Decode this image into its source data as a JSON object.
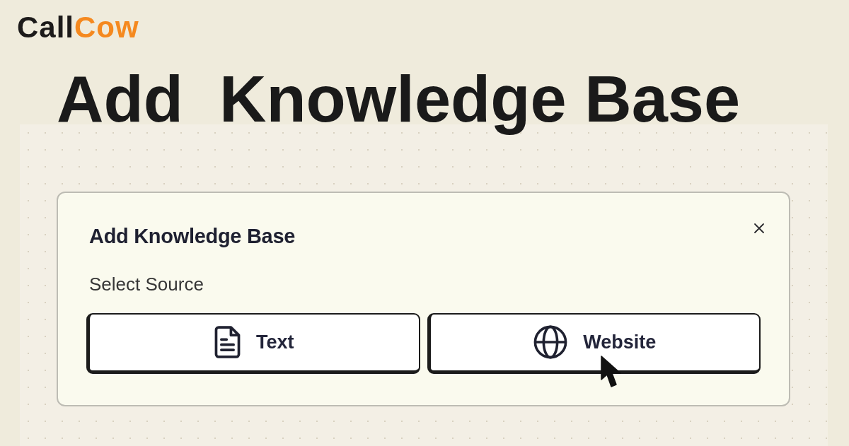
{
  "logo": [
    "Call",
    "Cow"
  ],
  "headline": "Add  Knowledge Base",
  "dialog": {
    "title": "Add Knowledge Base",
    "label": "Select Source",
    "sources": [
      {
        "kind": "document",
        "label": "Text",
        "hovered": false
      },
      {
        "kind": "globe",
        "label": "Website",
        "hovered": true
      }
    ]
  }
}
